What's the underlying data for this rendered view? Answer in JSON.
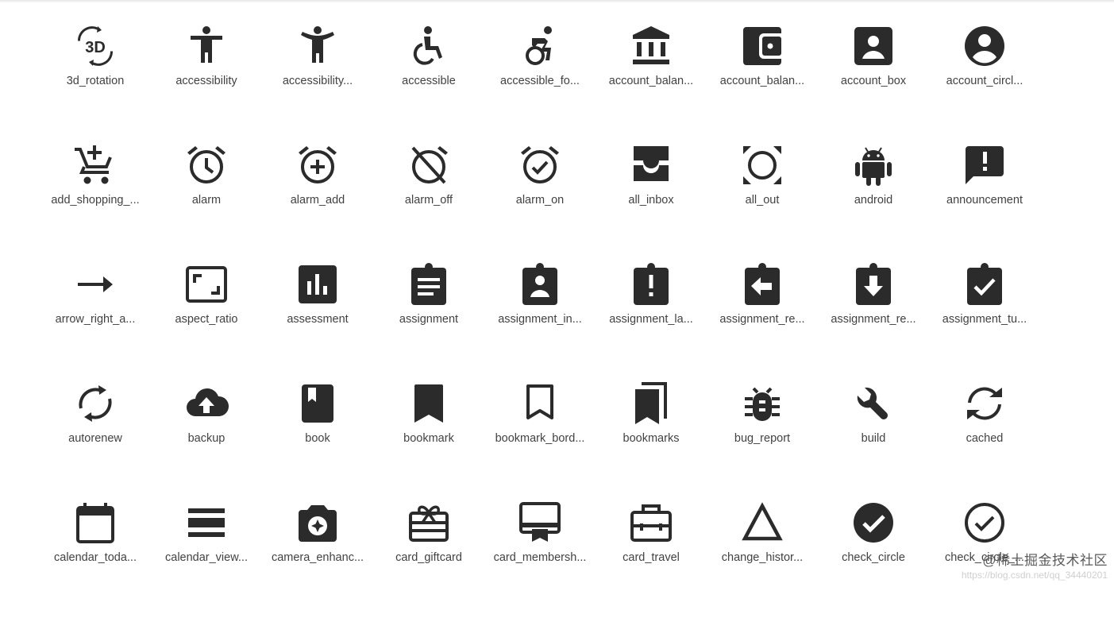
{
  "icons": [
    [
      {
        "icon": "3d-rotation-icon",
        "label": "3d_rotation"
      },
      {
        "icon": "accessibility-icon",
        "label": "accessibility"
      },
      {
        "icon": "accessibility-new-icon",
        "label": "accessibility..."
      },
      {
        "icon": "accessible-icon",
        "label": "accessible"
      },
      {
        "icon": "accessible-forward-icon",
        "label": "accessible_fo..."
      },
      {
        "icon": "account-balance-icon",
        "label": "account_balan..."
      },
      {
        "icon": "account-balance-wallet-icon",
        "label": "account_balan..."
      },
      {
        "icon": "account-box-icon",
        "label": "account_box"
      },
      {
        "icon": "account-circle-icon",
        "label": "account_circl..."
      }
    ],
    [
      {
        "icon": "add-shopping-cart-icon",
        "label": "add_shopping_..."
      },
      {
        "icon": "alarm-icon",
        "label": "alarm"
      },
      {
        "icon": "alarm-add-icon",
        "label": "alarm_add"
      },
      {
        "icon": "alarm-off-icon",
        "label": "alarm_off"
      },
      {
        "icon": "alarm-on-icon",
        "label": "alarm_on"
      },
      {
        "icon": "all-inbox-icon",
        "label": "all_inbox"
      },
      {
        "icon": "all-out-icon",
        "label": "all_out"
      },
      {
        "icon": "android-icon",
        "label": "android"
      },
      {
        "icon": "announcement-icon",
        "label": "announcement"
      }
    ],
    [
      {
        "icon": "arrow-right-alt-icon",
        "label": "arrow_right_a..."
      },
      {
        "icon": "aspect-ratio-icon",
        "label": "aspect_ratio"
      },
      {
        "icon": "assessment-icon",
        "label": "assessment"
      },
      {
        "icon": "assignment-icon",
        "label": "assignment"
      },
      {
        "icon": "assignment-ind-icon",
        "label": "assignment_in..."
      },
      {
        "icon": "assignment-late-icon",
        "label": "assignment_la..."
      },
      {
        "icon": "assignment-return-icon",
        "label": "assignment_re..."
      },
      {
        "icon": "assignment-returned-icon",
        "label": "assignment_re..."
      },
      {
        "icon": "assignment-turned-in-icon",
        "label": "assignment_tu..."
      }
    ],
    [
      {
        "icon": "autorenew-icon",
        "label": "autorenew"
      },
      {
        "icon": "backup-icon",
        "label": "backup"
      },
      {
        "icon": "book-icon",
        "label": "book"
      },
      {
        "icon": "bookmark-icon",
        "label": "bookmark"
      },
      {
        "icon": "bookmark-border-icon",
        "label": "bookmark_bord..."
      },
      {
        "icon": "bookmarks-icon",
        "label": "bookmarks"
      },
      {
        "icon": "bug-report-icon",
        "label": "bug_report"
      },
      {
        "icon": "build-icon",
        "label": "build"
      },
      {
        "icon": "cached-icon",
        "label": "cached"
      }
    ],
    [
      {
        "icon": "calendar-today-icon",
        "label": "calendar_toda..."
      },
      {
        "icon": "calendar-view-day-icon",
        "label": "calendar_view..."
      },
      {
        "icon": "camera-enhance-icon",
        "label": "camera_enhanc..."
      },
      {
        "icon": "card-giftcard-icon",
        "label": "card_giftcard"
      },
      {
        "icon": "card-membership-icon",
        "label": "card_membersh..."
      },
      {
        "icon": "card-travel-icon",
        "label": "card_travel"
      },
      {
        "icon": "change-history-icon",
        "label": "change_histor..."
      },
      {
        "icon": "check-circle-icon",
        "label": "check_circle"
      },
      {
        "icon": "check-circle-outline-icon",
        "label": "check_circle_..."
      }
    ]
  ],
  "watermark": {
    "title": "@稀土掘金技术社区",
    "url": "https://blog.csdn.net/qq_34440201"
  },
  "colors": {
    "icon": "#2b2b2b",
    "label": "#424242",
    "background": "#ffffff"
  }
}
